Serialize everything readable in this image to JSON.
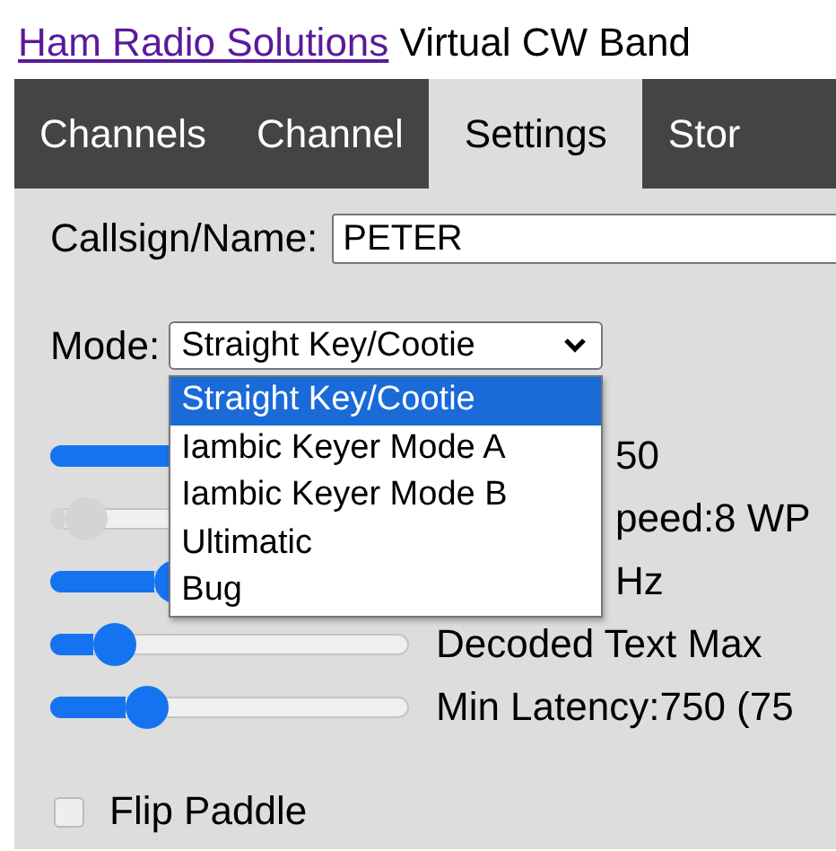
{
  "header": {
    "link": "Ham Radio Solutions",
    "title": "Virtual CW Band"
  },
  "tabs": [
    {
      "label": "Channels",
      "selected": false
    },
    {
      "label": "Channel",
      "selected": false
    },
    {
      "label": "Settings",
      "selected": true
    },
    {
      "label": "Stor",
      "selected": false
    }
  ],
  "callsign": {
    "label": "Callsign/Name:",
    "value": "PETER"
  },
  "mode": {
    "label": "Mode:",
    "value": "Straight Key/Cootie",
    "expanded": true,
    "options": [
      {
        "label": "Straight Key/Cootie",
        "selected": true
      },
      {
        "label": "Iambic Keyer Mode A",
        "selected": false
      },
      {
        "label": "Iambic Keyer Mode B",
        "selected": false
      },
      {
        "label": "Ultimatic",
        "selected": false
      },
      {
        "label": "Bug",
        "selected": false
      }
    ]
  },
  "sliders": [
    {
      "kind": "covered",
      "label": "50",
      "disabled": false
    },
    {
      "kind": "covered",
      "label": "peed:8 WP",
      "level": 0.1,
      "disabled": true
    },
    {
      "kind": "covered",
      "label": "Hz",
      "level": 0.35,
      "disabled": false
    },
    {
      "kind": "plain",
      "label": "Decoded Text Max",
      "level": 0.18,
      "disabled": false
    },
    {
      "kind": "plain",
      "label": "Min Latency:750 (75",
      "level": 0.27,
      "disabled": false
    }
  ],
  "flip_paddle": {
    "label": "Flip Paddle",
    "checked": false
  }
}
